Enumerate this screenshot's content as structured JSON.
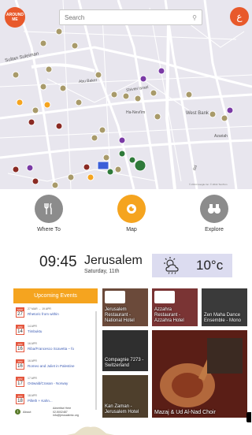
{
  "map": {
    "search_placeholder": "Search",
    "around_me_label": "AROUND ME",
    "lang_label": "ع",
    "street_labels": [
      "Sultan Suleiman",
      "Abu Baker",
      "Shivtei Israel",
      "Ha-Nevi'im",
      "West Bank",
      "Rd",
      "Azariah"
    ],
    "attribution": "© 2014 Google Inc. © 2014 TomTom"
  },
  "nav": {
    "items": [
      {
        "label": "Where To",
        "icon": "cutlery-icon",
        "color": "#8c8c8c"
      },
      {
        "label": "Map",
        "icon": "map-pin-icon",
        "color": "#f5a41f"
      },
      {
        "label": "Explore",
        "icon": "binoculars-icon",
        "color": "#8c8c8c"
      }
    ]
  },
  "clock": {
    "time": "09:45",
    "city": "Jerusalem",
    "date": "Saturday, 11th",
    "temperature": "10°c",
    "weather_icon": "partly-cloudy-icon"
  },
  "events": {
    "header": "Upcoming Events",
    "items": [
      {
        "month": "MAR",
        "day": "27",
        "date_range": "27 MAR  → 19 APR",
        "title": "Rhetoric from within"
      },
      {
        "month": "APR",
        "day": "14",
        "date_range": "14 APR",
        "title": "Timbuktu"
      },
      {
        "month": "APR",
        "day": "16",
        "date_range": "16 APR",
        "title": "Riba/Francesco Scavetta – fo"
      },
      {
        "month": "APR",
        "day": "16",
        "date_range": "16 APR",
        "title": "Romeo and Juliet in Palestine"
      },
      {
        "month": "APR",
        "day": "17",
        "date_range": "17 APR",
        "title": "Ostwald/Crasan - Norway"
      },
      {
        "month": "APR",
        "day": "18",
        "date_range": "18 APR",
        "title": "Pilleth + Kahn..."
      }
    ],
    "about_label": "About",
    "advertise_label": "Advertise Here",
    "phone": "02-5002487",
    "email": "info@jerusalemic.org"
  },
  "tiles": [
    {
      "label": "Jerusalem Restaurant - National Hotel",
      "color": "#6b4a3a"
    },
    {
      "label": "Azzahra Restaurant - Azzahra Hotel",
      "color": "#7a3434"
    },
    {
      "label": "Zen Maha Dance Ensemble - Mono",
      "color": "#3a3a3a"
    },
    {
      "label": "Compagnie 7273 - Switzerland",
      "color": "#2f2f2f"
    },
    {
      "label": "Kan Zaman - Jerusalem Hotel",
      "color": "#4e3f2c"
    },
    {
      "label": "Mazaj & Ud Al-Nad Choir",
      "color": "#7a2a1d"
    }
  ]
}
